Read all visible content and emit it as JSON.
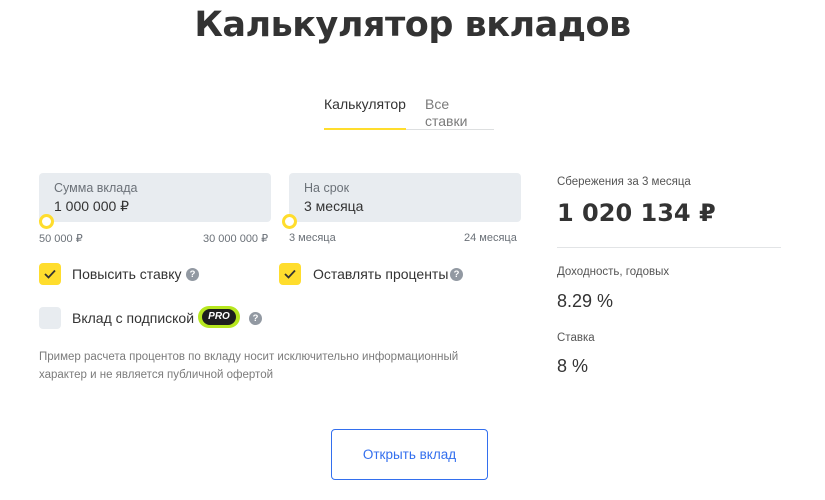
{
  "title": "Калькулятор вкладов",
  "tabs": [
    {
      "label": "Калькулятор",
      "active": true
    },
    {
      "label": "Все ставки",
      "active": false
    }
  ],
  "deposit_amount": {
    "label": "Сумма вклада",
    "value": "1 000 000 ₽",
    "min_label": "50 000 ₽",
    "max_label": "30 000 000 ₽",
    "slider_fraction": 0.03
  },
  "term": {
    "label": "На срок",
    "value": "3 месяца",
    "min_label": "3 месяца",
    "max_label": "24 месяца",
    "slider_fraction": 0.0
  },
  "options": {
    "increase_rate": {
      "label": "Повысить ставку",
      "checked": true
    },
    "keep_interest": {
      "label": "Оставлять проценты",
      "checked": true
    },
    "subscription": {
      "label": "Вклад с подпиской",
      "checked": false,
      "badge": "PRO"
    }
  },
  "disclaimer": "Пример расчета процентов по вкладу носит исключительно информационный характер и не является публичной офертой",
  "results": {
    "savings_label": "Сбережения за 3 месяца",
    "savings_value": "1 020 134 ₽",
    "yield_label": "Доходность, годовых",
    "yield_value": "8.29 %",
    "rate_label": "Ставка",
    "rate_value": "8 %"
  },
  "open_button": "Открыть вклад",
  "colors": {
    "accent": "#ffdd2d",
    "link": "#336fee",
    "pro_badge": "#b7e71f",
    "field_bg": "#e8ecf0"
  }
}
